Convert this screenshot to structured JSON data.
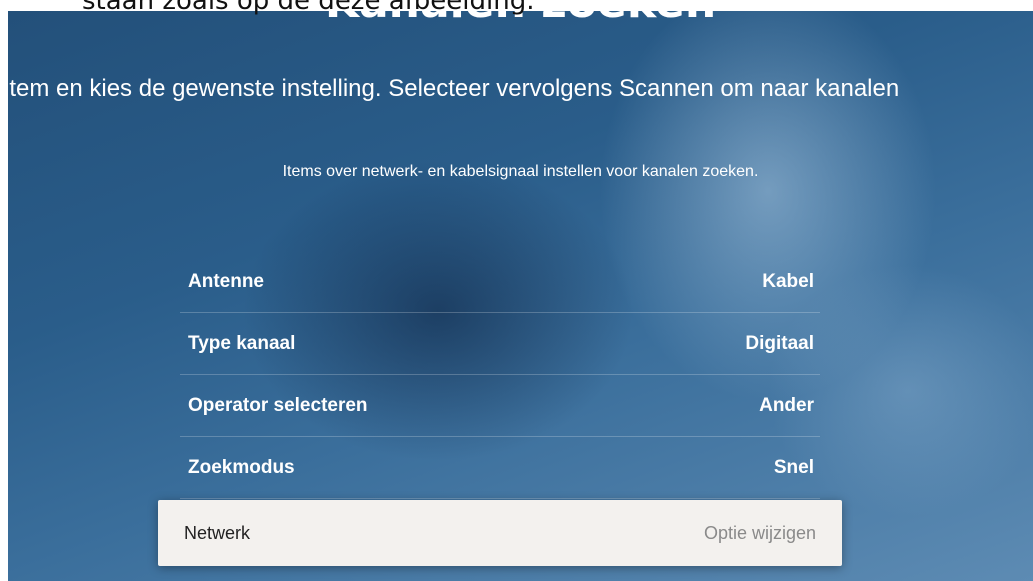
{
  "caption": "staan zoals op de deze afbeelding.",
  "screen": {
    "title": "Kanalen zoeken",
    "instruction": "item en kies de gewenste instelling. Selecteer vervolgens Scannen om naar kanalen",
    "description": "Items over netwerk- en kabelsignaal instellen voor kanalen zoeken."
  },
  "settings": [
    {
      "label": "Antenne",
      "value": "Kabel"
    },
    {
      "label": "Type kanaal",
      "value": "Digitaal"
    },
    {
      "label": "Operator selecteren",
      "value": "Ander"
    },
    {
      "label": "Zoekmodus",
      "value": "Snel"
    },
    {
      "label": "Netwerk",
      "value": "Optie wijzigen"
    }
  ]
}
